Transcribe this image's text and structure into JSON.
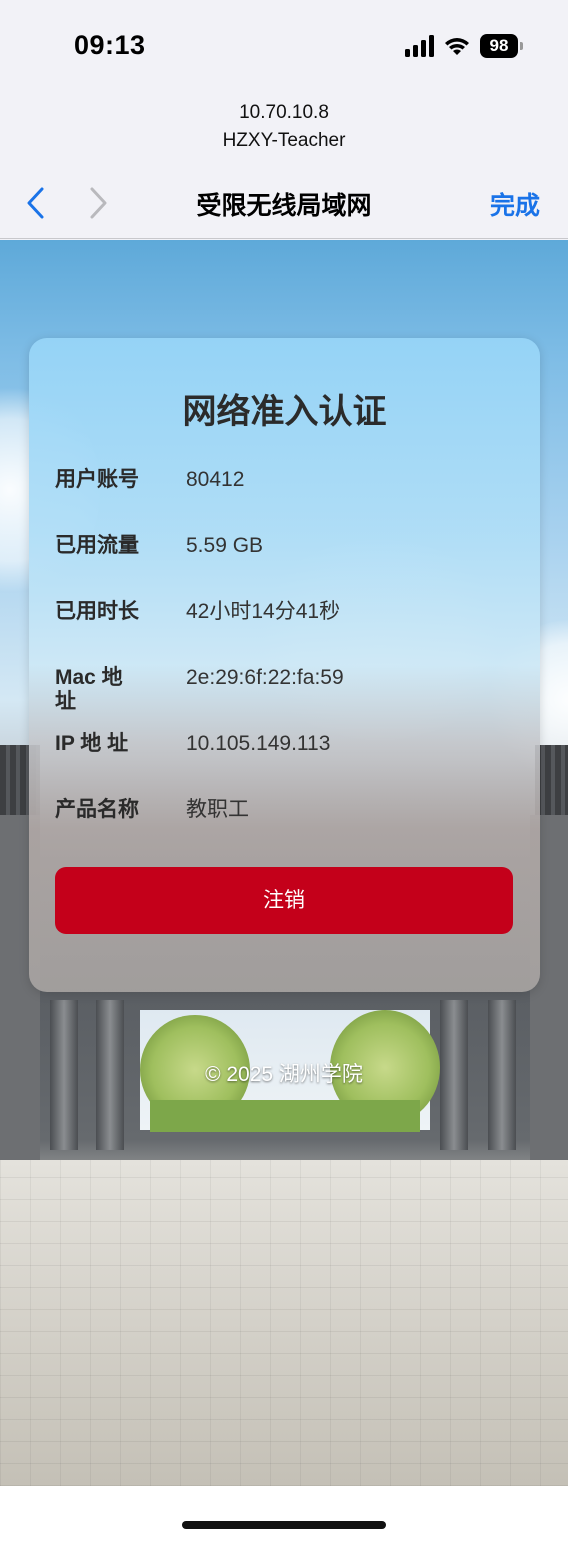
{
  "status_bar": {
    "time": "09:13",
    "battery": "98",
    "icons": [
      "cellular-signal-icon",
      "wifi-icon",
      "battery-icon"
    ]
  },
  "url_header": {
    "ip": "10.70.10.8",
    "ssid": "HZXY-Teacher"
  },
  "nav": {
    "title": "受限无线局域网",
    "done_label": "完成",
    "back_icon": "chevron-left-icon",
    "forward_icon": "chevron-right-icon",
    "accent_color": "#1a73e8"
  },
  "auth_card": {
    "title": "网络准入认证",
    "rows": [
      {
        "label": "用户账号",
        "value": "80412"
      },
      {
        "label": "已用流量",
        "value": "5.59 GB"
      },
      {
        "label": "已用时长",
        "value": "42小时14分41秒"
      },
      {
        "label": "Mac 地址",
        "value": "2e:29:6f:22:fa:59"
      },
      {
        "label": "IP 地 址",
        "value": "10.105.149.113"
      },
      {
        "label": "产品名称",
        "value": "教职工"
      }
    ],
    "logout_label": "注销",
    "logout_color": "#c4001a"
  },
  "footer": {
    "copyright": "© 2025 湖州学院"
  }
}
